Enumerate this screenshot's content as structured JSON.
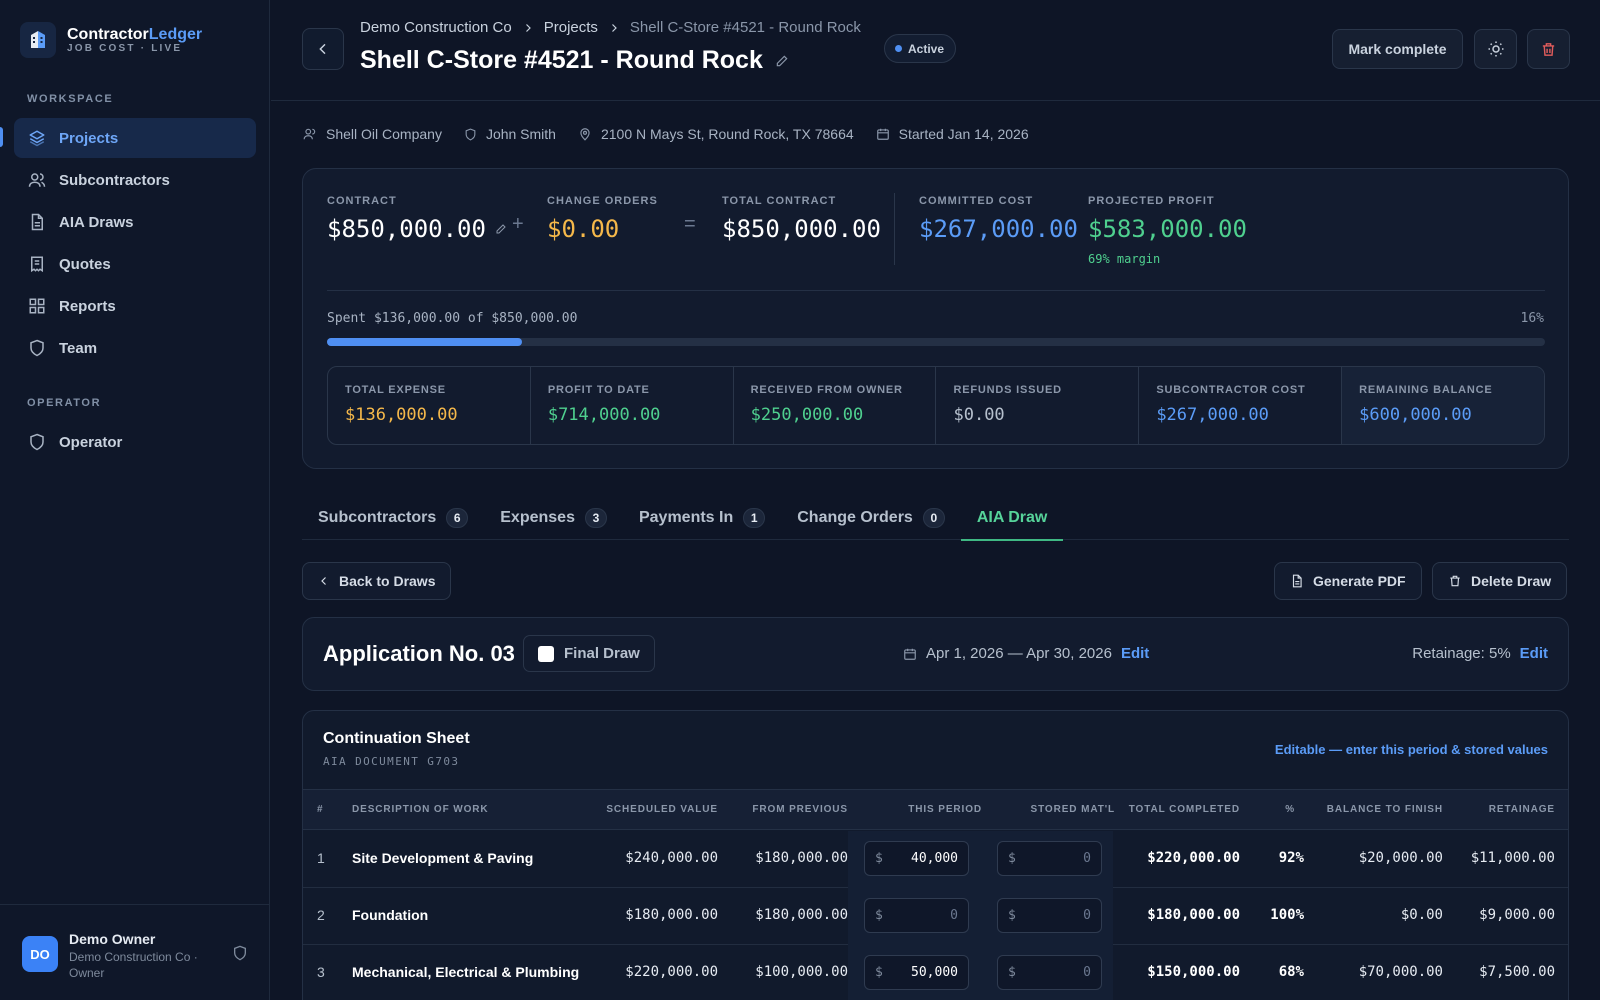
{
  "brand": {
    "name_main": "Contractor",
    "name_accent": "Ledger",
    "subtitle": "JOB COST · LIVE"
  },
  "sidebar": {
    "workspace_label": "WORKSPACE",
    "items": [
      {
        "label": "Projects",
        "icon": "layers-icon"
      },
      {
        "label": "Subcontractors",
        "icon": "users-icon"
      },
      {
        "label": "AIA Draws",
        "icon": "document-icon"
      },
      {
        "label": "Quotes",
        "icon": "receipt-icon"
      },
      {
        "label": "Reports",
        "icon": "grid-icon"
      },
      {
        "label": "Team",
        "icon": "shield-icon"
      }
    ],
    "operator_label": "OPERATOR",
    "operator_item": "Operator",
    "user": {
      "initials": "DO",
      "name": "Demo Owner",
      "org": "Demo Construction Co · Owner"
    }
  },
  "header": {
    "breadcrumb": [
      "Demo Construction Co",
      "Projects",
      "Shell C-Store #4521 - Round Rock"
    ],
    "title": "Shell C-Store #4521 - Round Rock",
    "status": "Active",
    "mark_complete": "Mark complete"
  },
  "meta": {
    "client": "Shell Oil Company",
    "manager": "John Smith",
    "address": "2100 N Mays St, Round Rock, TX 78664",
    "started": "Started Jan 14, 2026"
  },
  "summary": {
    "contract_label": "CONTRACT",
    "contract": "$850,000.00",
    "change_orders_label": "CHANGE ORDERS",
    "change_orders": "$0.00",
    "total_contract_label": "TOTAL CONTRACT",
    "total_contract": "$850,000.00",
    "committed_label": "COMMITTED COST",
    "committed": "$267,000.00",
    "profit_label": "PROJECTED PROFIT",
    "profit": "$583,000.00",
    "margin": "69% margin",
    "spent_text": "Spent $136,000.00 of $850,000.00",
    "spent_pct": "16%",
    "spent_fraction": 0.16,
    "kpis": [
      {
        "label": "TOTAL EXPENSE",
        "value": "$136,000.00",
        "color": "#f5b84a"
      },
      {
        "label": "PROFIT TO DATE",
        "value": "$714,000.00",
        "color": "#4fd08f"
      },
      {
        "label": "RECEIVED FROM OWNER",
        "value": "$250,000.00",
        "color": "#4fd08f"
      },
      {
        "label": "REFUNDS ISSUED",
        "value": "$0.00",
        "color": "#b6c0cd"
      },
      {
        "label": "SUBCONTRACTOR COST",
        "value": "$267,000.00",
        "color": "#5b9cf7"
      },
      {
        "label": "REMAINING BALANCE",
        "value": "$600,000.00",
        "color": "#5b9cf7"
      }
    ]
  },
  "tabs": [
    {
      "label": "Subcontractors",
      "count": "6"
    },
    {
      "label": "Expenses",
      "count": "3"
    },
    {
      "label": "Payments In",
      "count": "1"
    },
    {
      "label": "Change Orders",
      "count": "0"
    },
    {
      "label": "AIA Draw",
      "count": ""
    }
  ],
  "toolbar": {
    "back": "Back to Draws",
    "pdf": "Generate PDF",
    "delete": "Delete Draw"
  },
  "application": {
    "title": "Application No. 03",
    "final_draw": "Final Draw",
    "period": "Apr 1, 2026 — Apr 30, 2026",
    "edit": "Edit",
    "retainage": "Retainage: 5%"
  },
  "sheet": {
    "title": "Continuation Sheet",
    "subtitle": "AIA DOCUMENT G703",
    "note": "Editable — enter this period & stored values",
    "columns": [
      "#",
      "DESCRIPTION OF WORK",
      "SCHEDULED VALUE",
      "FROM PREVIOUS",
      "THIS PERIOD",
      "STORED MAT'L",
      "TOTAL COMPLETED",
      "%",
      "BALANCE TO FINISH",
      "RETAINAGE"
    ],
    "rows": [
      {
        "num": "1",
        "desc": "Site Development & Paving",
        "scheduled": "$240,000.00",
        "previous": "$180,000.00",
        "this_period": "40,000",
        "stored": "0",
        "total": "$220,000.00",
        "pct": "92%",
        "balance": "$20,000.00",
        "retainage": "$11,000.00"
      },
      {
        "num": "2",
        "desc": "Foundation",
        "scheduled": "$180,000.00",
        "previous": "$180,000.00",
        "this_period": "0",
        "stored": "0",
        "total": "$180,000.00",
        "pct": "100%",
        "balance": "$0.00",
        "retainage": "$9,000.00"
      },
      {
        "num": "3",
        "desc": "Mechanical, Electrical & Plumbing",
        "scheduled": "$220,000.00",
        "previous": "$100,000.00",
        "this_period": "50,000",
        "stored": "0",
        "total": "$150,000.00",
        "pct": "68%",
        "balance": "$70,000.00",
        "retainage": "$7,500.00"
      }
    ]
  },
  "colors": {
    "accent": "#5b9cf7",
    "success": "#4fd08f",
    "warning": "#f5b84a",
    "danger": "#e25c5c"
  }
}
